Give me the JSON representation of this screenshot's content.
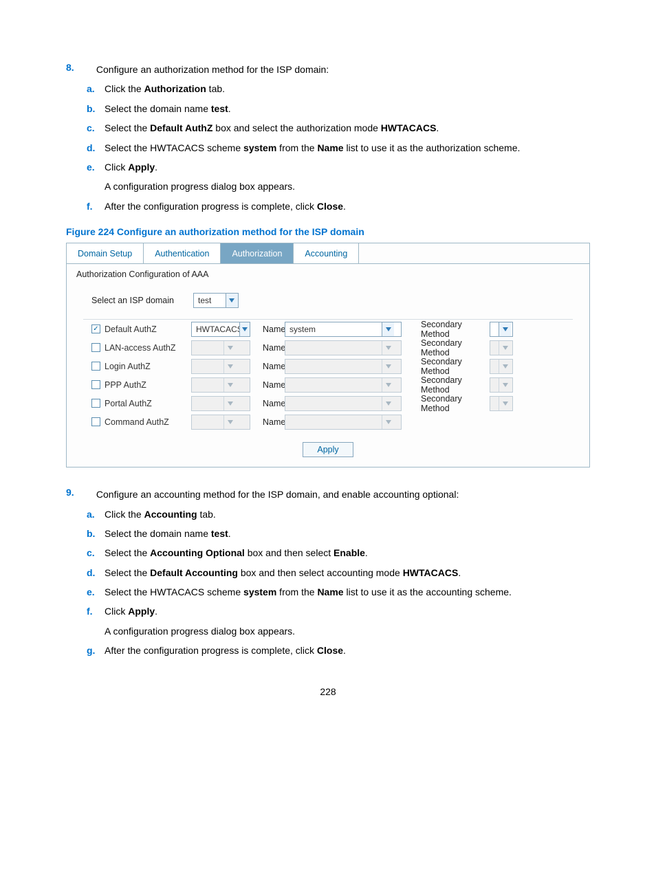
{
  "step8": {
    "num": "8.",
    "text": "Configure an authorization method for the ISP domain:",
    "subs": [
      {
        "l": "a.",
        "pre": "Click the ",
        "b": "Authorization",
        "post": " tab."
      },
      {
        "l": "b.",
        "pre": "Select the domain name ",
        "b": "test",
        "post": "."
      },
      {
        "l": "c.",
        "pre": "Select the ",
        "b": "Default AuthZ",
        "mid": " box and select the authorization mode ",
        "b2": "HWTACACS",
        "post": "."
      },
      {
        "l": "d.",
        "pre": "Select the HWTACACS scheme ",
        "b": "system",
        "mid": " from the ",
        "b2": "Name",
        "post": " list to use it as the authorization scheme."
      },
      {
        "l": "e.",
        "pre": "Click ",
        "b": "Apply",
        "post": "."
      },
      {
        "note": "A configuration progress dialog box appears."
      },
      {
        "l": "f.",
        "pre": "After the configuration progress is complete, click ",
        "b": "Close",
        "post": "."
      }
    ]
  },
  "fig_caption": "Figure 224 Configure an authorization method for the ISP domain",
  "panel": {
    "tabs": [
      "Domain Setup",
      "Authentication",
      "Authorization",
      "Accounting"
    ],
    "active_tab": 2,
    "section_title": "Authorization Configuration of AAA",
    "domain_label": "Select an ISP domain",
    "domain_value": "test",
    "rows": [
      {
        "checked": true,
        "label": "Default AuthZ",
        "method": "HWTACACS",
        "name_label": "Name",
        "name_value": "system",
        "has_secondary": true,
        "sec_label": "Secondary Method",
        "enabled": true
      },
      {
        "checked": false,
        "label": "LAN-access AuthZ",
        "method": "",
        "name_label": "Name",
        "name_value": "",
        "has_secondary": true,
        "sec_label": "Secondary Method",
        "enabled": false
      },
      {
        "checked": false,
        "label": "Login AuthZ",
        "method": "",
        "name_label": "Name",
        "name_value": "",
        "has_secondary": true,
        "sec_label": "Secondary Method",
        "enabled": false
      },
      {
        "checked": false,
        "label": "PPP AuthZ",
        "method": "",
        "name_label": "Name",
        "name_value": "",
        "has_secondary": true,
        "sec_label": "Secondary Method",
        "enabled": false
      },
      {
        "checked": false,
        "label": "Portal AuthZ",
        "method": "",
        "name_label": "Name",
        "name_value": "",
        "has_secondary": true,
        "sec_label": "Secondary Method",
        "enabled": false
      },
      {
        "checked": false,
        "label": "Command AuthZ",
        "method": "",
        "name_label": "Name",
        "name_value": "",
        "has_secondary": false,
        "sec_label": "",
        "enabled": false
      }
    ],
    "apply_label": "Apply"
  },
  "step9": {
    "num": "9.",
    "text": "Configure an accounting method for the ISP domain, and enable accounting optional:",
    "subs": [
      {
        "l": "a.",
        "pre": "Click the ",
        "b": "Accounting",
        "post": " tab."
      },
      {
        "l": "b.",
        "pre": "Select the domain name ",
        "b": "test",
        "post": "."
      },
      {
        "l": "c.",
        "pre": "Select the ",
        "b": "Accounting Optional",
        "mid": " box and then select ",
        "b2": "Enable",
        "post": "."
      },
      {
        "l": "d.",
        "pre": "Select the ",
        "b": "Default Accounting",
        "mid": " box and then select accounting mode ",
        "b2": "HWTACACS",
        "post": "."
      },
      {
        "l": "e.",
        "pre": "Select the HWTACACS scheme ",
        "b": "system",
        "mid": " from the ",
        "b2": "Name",
        "post": " list to use it as the accounting scheme."
      },
      {
        "l": "f.",
        "pre": "Click ",
        "b": "Apply",
        "post": "."
      },
      {
        "note": "A configuration progress dialog box appears."
      },
      {
        "l": "g.",
        "pre": "After the configuration progress is complete, click ",
        "b": "Close",
        "post": "."
      }
    ]
  },
  "page_number": "228"
}
